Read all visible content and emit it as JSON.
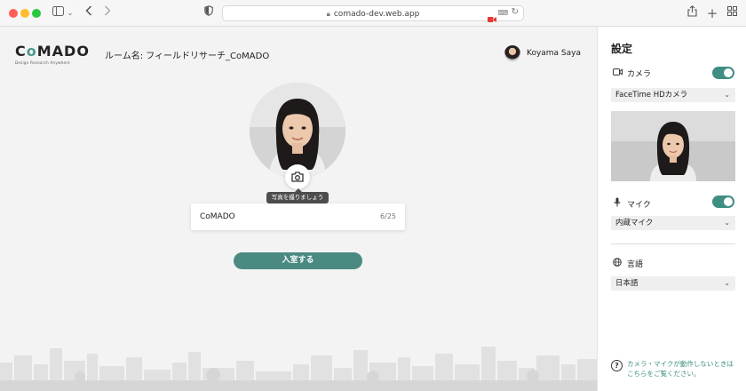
{
  "browser": {
    "url": "comado-dev.web.app"
  },
  "header": {
    "logo_text_c": "C",
    "logo_text_o": "o",
    "logo_text_rest": "MADO",
    "logo_subtitle": "Design Research Anywhere",
    "room_label": "ルーム名: フィールドリサーチ_CoMADO",
    "user_name": "Koyama Saya"
  },
  "main": {
    "photo_tooltip": "写真を撮りましょう",
    "name_input": {
      "value": "CoMADO",
      "counter": "6/25"
    },
    "enter_button": "入室する"
  },
  "settings": {
    "title": "設定",
    "camera": {
      "label": "カメラ",
      "enabled": true,
      "device": "FaceTime HDカメラ"
    },
    "mic": {
      "label": "マイク",
      "enabled": true,
      "device": "内蔵マイク"
    },
    "language": {
      "label": "言語",
      "value": "日本語"
    },
    "help_text": "カメラ・マイクが動作しないときはこちらをご覧ください。"
  },
  "colors": {
    "accent": "#3f8e84",
    "button": "#4a8a80"
  }
}
